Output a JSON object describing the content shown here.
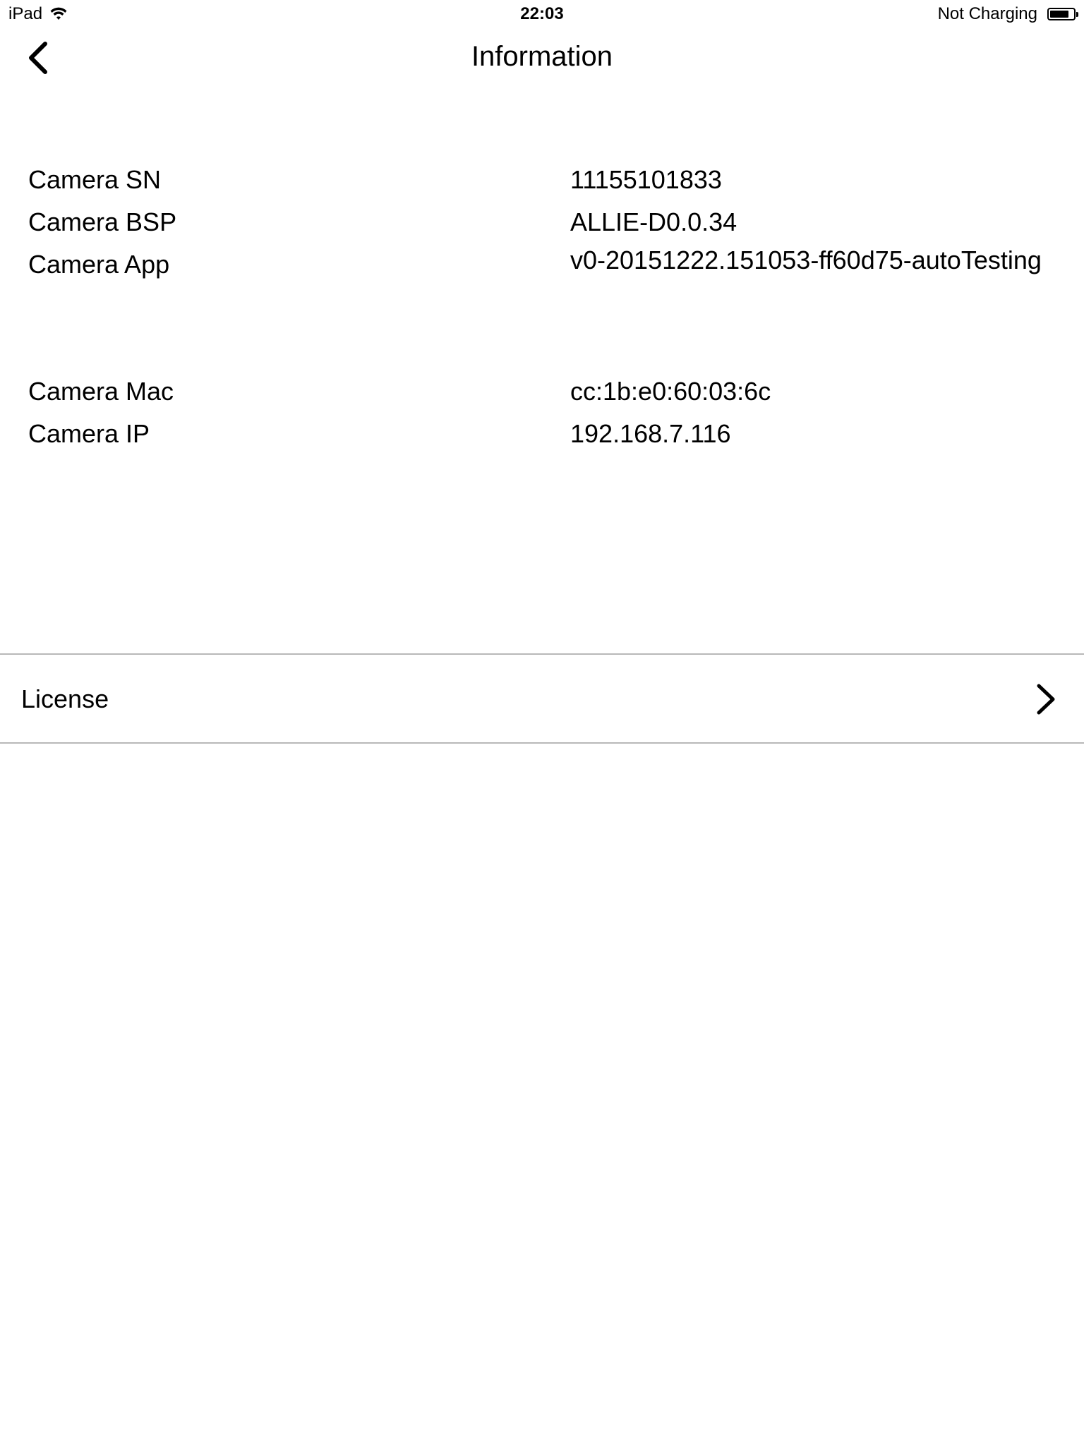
{
  "status_bar": {
    "device": "iPad",
    "time": "22:03",
    "charging_status": "Not Charging",
    "battery_level": 0.8,
    "icons": [
      "wifi-icon",
      "battery-icon"
    ]
  },
  "nav": {
    "title": "Information",
    "back_icon": "chevron-left-icon"
  },
  "camera_info": [
    {
      "label": "Camera SN",
      "value": "11155101833"
    },
    {
      "label": "Camera BSP",
      "value": "ALLIE-D0.0.34"
    },
    {
      "label": "Camera App",
      "value": "v0-20151222.151053-ff60d75-autoTesting"
    }
  ],
  "network_info": [
    {
      "label": "Camera Mac",
      "value": "cc:1b:e0:60:03:6c"
    },
    {
      "label": "Camera IP",
      "value": "192.168.7.116"
    }
  ],
  "license": {
    "label": "License",
    "icon": "chevron-right-icon"
  },
  "colors": {
    "background": "#ffffff",
    "text": "#000000",
    "divider": "#b8b8b8"
  }
}
